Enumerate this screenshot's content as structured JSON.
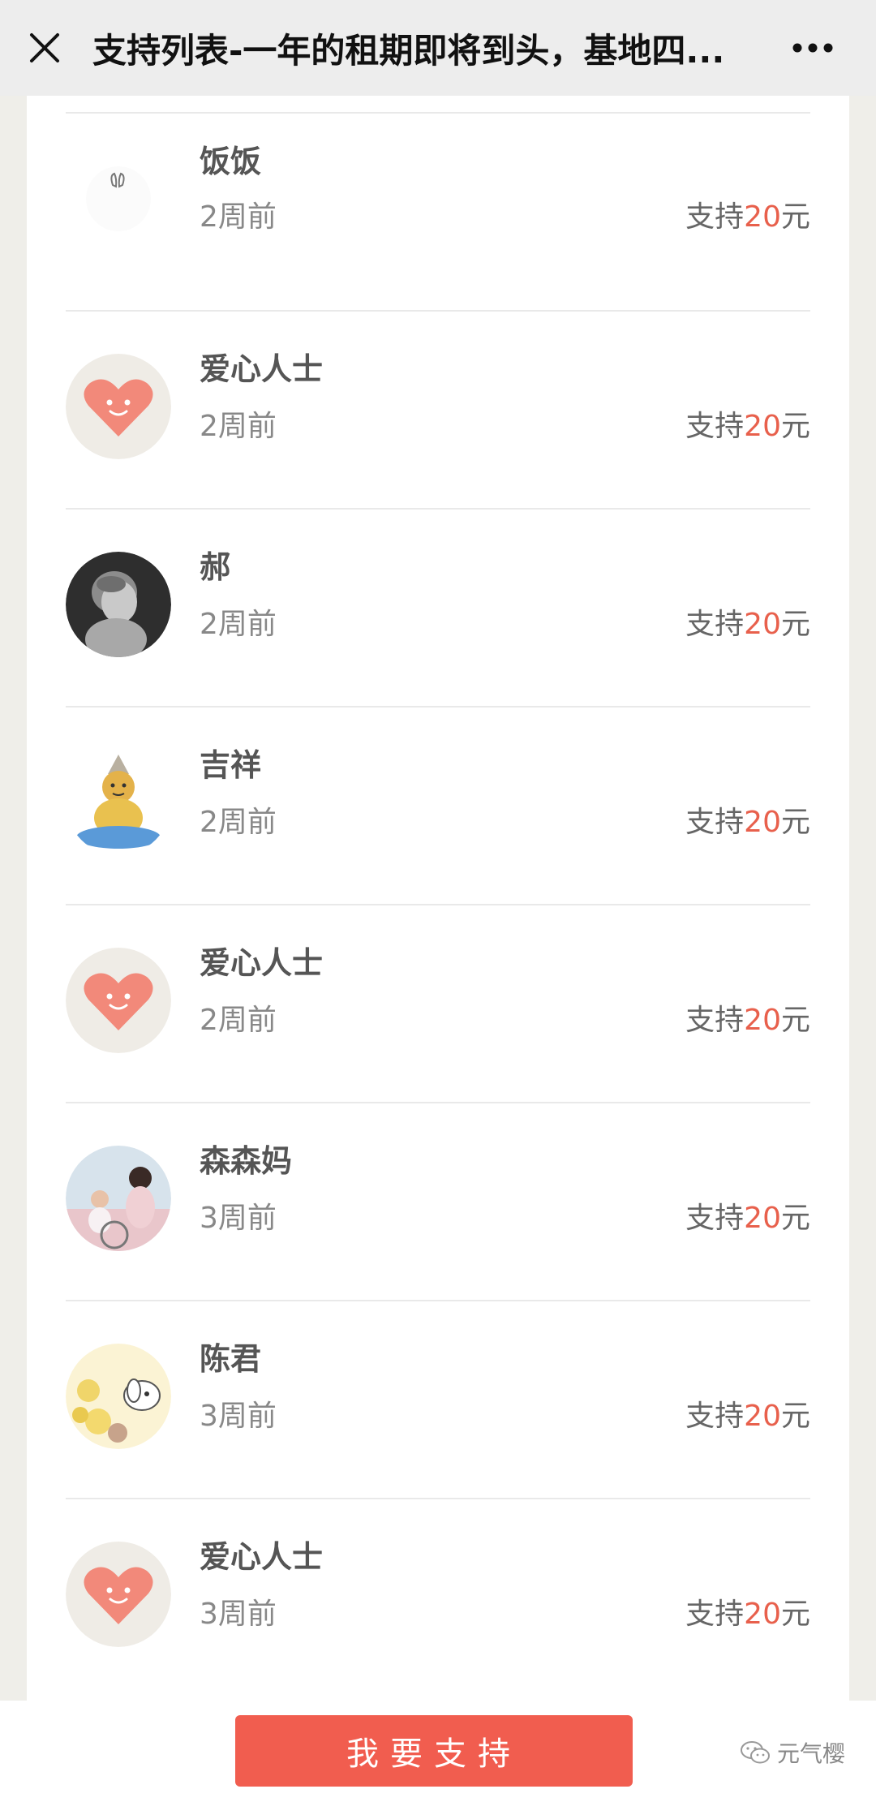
{
  "header": {
    "title": "支持列表-一年的租期即将到头，基地四...",
    "close_icon": "close-icon",
    "more_icon": "more-dots-icon"
  },
  "supporters": [
    {
      "name": "饭饭",
      "time": "2周前",
      "amount_prefix": "支持",
      "amount": "20",
      "amount_suffix": "元",
      "avatar": "bunny-avatar"
    },
    {
      "name": "爱心人士",
      "time": "2周前",
      "amount_prefix": "支持",
      "amount": "20",
      "amount_suffix": "元",
      "avatar": "heart-avatar"
    },
    {
      "name": "郝",
      "time": "2周前",
      "amount_prefix": "支持",
      "amount": "20",
      "amount_suffix": "元",
      "avatar": "statue-photo-avatar"
    },
    {
      "name": "吉祥",
      "time": "2周前",
      "amount_prefix": "支持",
      "amount": "20",
      "amount_suffix": "元",
      "avatar": "buddha-cartoon-avatar"
    },
    {
      "name": "爱心人士",
      "time": "2周前",
      "amount_prefix": "支持",
      "amount": "20",
      "amount_suffix": "元",
      "avatar": "heart-avatar"
    },
    {
      "name": "森森妈",
      "time": "3周前",
      "amount_prefix": "支持",
      "amount": "20",
      "amount_suffix": "元",
      "avatar": "family-photo-avatar"
    },
    {
      "name": "陈君",
      "time": "3周前",
      "amount_prefix": "支持",
      "amount": "20",
      "amount_suffix": "元",
      "avatar": "dog-illustration-avatar"
    },
    {
      "name": "爱心人士",
      "time": "3周前",
      "amount_prefix": "支持",
      "amount": "20",
      "amount_suffix": "元",
      "avatar": "heart-avatar"
    }
  ],
  "footer": {
    "support_button": "我要支持",
    "watermark": "元气樱"
  },
  "colors": {
    "accent": "#f15d4f",
    "amount_number": "#e8604c",
    "heart": "#f2897a"
  }
}
